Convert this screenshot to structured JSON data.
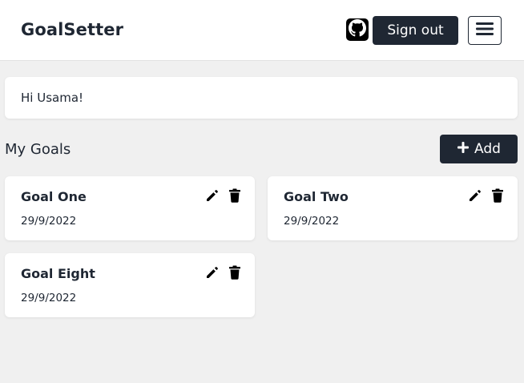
{
  "navbar": {
    "brand": "GoalSetter",
    "github_icon": "github-icon",
    "signout_label": "Sign out",
    "menu_icon": "hamburger-menu-icon"
  },
  "greeting": {
    "text": "Hi Usama!"
  },
  "goals_section": {
    "title": "My Goals",
    "add_label": "Add",
    "add_icon": "plus-icon"
  },
  "goals": [
    {
      "title": "Goal One",
      "date": "29/9/2022",
      "edit_icon": "pencil-icon",
      "delete_icon": "trash-icon"
    },
    {
      "title": "Goal Two",
      "date": "29/9/2022",
      "edit_icon": "pencil-icon",
      "delete_icon": "trash-icon"
    },
    {
      "title": "Goal Eight",
      "date": "29/9/2022",
      "edit_icon": "pencil-icon",
      "delete_icon": "trash-icon"
    }
  ],
  "colors": {
    "primary_dark": "#1f2733",
    "background": "#f0f0f0",
    "card": "#ffffff"
  }
}
